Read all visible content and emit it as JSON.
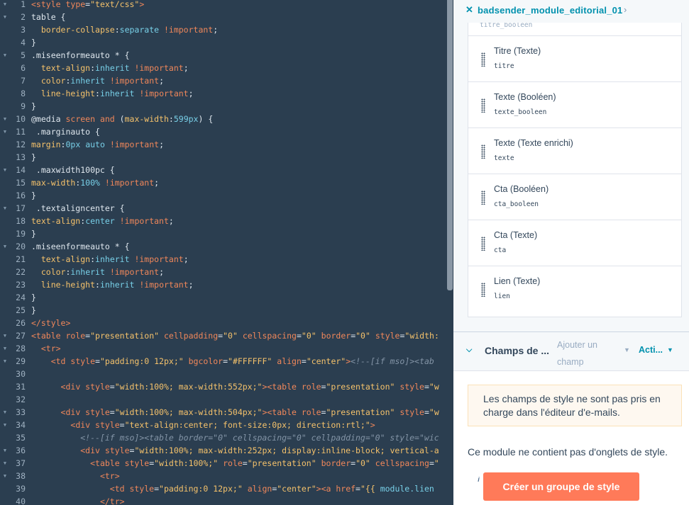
{
  "editor": {
    "lines": [
      {
        "n": "1",
        "fold": true,
        "tokens": [
          [
            "t-tag",
            "<style "
          ],
          [
            "t-attr",
            "type"
          ],
          [
            "t-plain",
            "="
          ],
          [
            "t-str",
            "\"text/css\""
          ],
          [
            "t-tag",
            ">"
          ]
        ]
      },
      {
        "n": "2",
        "fold": true,
        "tokens": [
          [
            "t-sel",
            "table "
          ],
          [
            "t-plain",
            "{"
          ]
        ]
      },
      {
        "n": "3",
        "fold": false,
        "tokens": [
          [
            "t-plain",
            "  "
          ],
          [
            "t-prop",
            "border-collapse"
          ],
          [
            "t-plain",
            ":"
          ],
          [
            "t-val",
            "separate"
          ],
          [
            "t-plain",
            " "
          ],
          [
            "t-imp",
            "!important"
          ],
          [
            "t-plain",
            ";"
          ]
        ]
      },
      {
        "n": "4",
        "fold": false,
        "tokens": [
          [
            "t-plain",
            "}"
          ]
        ]
      },
      {
        "n": "5",
        "fold": true,
        "tokens": [
          [
            "t-sel",
            ".miseenformeauto * "
          ],
          [
            "t-plain",
            "{"
          ]
        ]
      },
      {
        "n": "6",
        "fold": false,
        "tokens": [
          [
            "t-plain",
            "  "
          ],
          [
            "t-prop",
            "text-align"
          ],
          [
            "t-plain",
            ":"
          ],
          [
            "t-val",
            "inherit"
          ],
          [
            "t-plain",
            " "
          ],
          [
            "t-imp",
            "!important"
          ],
          [
            "t-plain",
            ";"
          ]
        ]
      },
      {
        "n": "7",
        "fold": false,
        "tokens": [
          [
            "t-plain",
            "  "
          ],
          [
            "t-prop",
            "color"
          ],
          [
            "t-plain",
            ":"
          ],
          [
            "t-val",
            "inherit"
          ],
          [
            "t-plain",
            " "
          ],
          [
            "t-imp",
            "!important"
          ],
          [
            "t-plain",
            ";"
          ]
        ]
      },
      {
        "n": "8",
        "fold": false,
        "tokens": [
          [
            "t-plain",
            "  "
          ],
          [
            "t-prop",
            "line-height"
          ],
          [
            "t-plain",
            ":"
          ],
          [
            "t-val",
            "inherit"
          ],
          [
            "t-plain",
            " "
          ],
          [
            "t-imp",
            "!important"
          ],
          [
            "t-plain",
            ";"
          ]
        ]
      },
      {
        "n": "9",
        "fold": false,
        "tokens": [
          [
            "t-plain",
            "}"
          ]
        ]
      },
      {
        "n": "10",
        "fold": true,
        "tokens": [
          [
            "t-plain",
            "@media "
          ],
          [
            "t-kw",
            "screen"
          ],
          [
            "t-plain",
            " "
          ],
          [
            "t-kw",
            "and"
          ],
          [
            "t-plain",
            " ("
          ],
          [
            "t-prop",
            "max-width"
          ],
          [
            "t-plain",
            ":"
          ],
          [
            "t-num",
            "599px"
          ],
          [
            "t-plain",
            ") {"
          ]
        ]
      },
      {
        "n": "11",
        "fold": true,
        "tokens": [
          [
            "t-sel",
            " .marginauto "
          ],
          [
            "t-plain",
            "{"
          ]
        ]
      },
      {
        "n": "12",
        "fold": false,
        "tokens": [
          [
            "t-prop",
            "margin"
          ],
          [
            "t-plain",
            ":"
          ],
          [
            "t-num",
            "0px"
          ],
          [
            "t-plain",
            " "
          ],
          [
            "t-val",
            "auto"
          ],
          [
            "t-plain",
            " "
          ],
          [
            "t-imp",
            "!important"
          ],
          [
            "t-plain",
            ";"
          ]
        ]
      },
      {
        "n": "13",
        "fold": false,
        "tokens": [
          [
            "t-plain",
            "}"
          ]
        ]
      },
      {
        "n": "14",
        "fold": true,
        "tokens": [
          [
            "t-sel",
            " .maxwidth100pc "
          ],
          [
            "t-plain",
            "{"
          ]
        ]
      },
      {
        "n": "15",
        "fold": false,
        "tokens": [
          [
            "t-prop",
            "max-width"
          ],
          [
            "t-plain",
            ":"
          ],
          [
            "t-num",
            "100%"
          ],
          [
            "t-plain",
            " "
          ],
          [
            "t-imp",
            "!important"
          ],
          [
            "t-plain",
            ";"
          ]
        ]
      },
      {
        "n": "16",
        "fold": false,
        "tokens": [
          [
            "t-plain",
            "}"
          ]
        ]
      },
      {
        "n": "17",
        "fold": true,
        "tokens": [
          [
            "t-sel",
            " .textaligncenter "
          ],
          [
            "t-plain",
            "{"
          ]
        ]
      },
      {
        "n": "18",
        "fold": false,
        "tokens": [
          [
            "t-prop",
            "text-align"
          ],
          [
            "t-plain",
            ":"
          ],
          [
            "t-val",
            "center"
          ],
          [
            "t-plain",
            " "
          ],
          [
            "t-imp",
            "!important"
          ],
          [
            "t-plain",
            ";"
          ]
        ]
      },
      {
        "n": "19",
        "fold": false,
        "tokens": [
          [
            "t-plain",
            "}"
          ]
        ]
      },
      {
        "n": "20",
        "fold": true,
        "tokens": [
          [
            "t-sel",
            ".miseenformeauto * "
          ],
          [
            "t-plain",
            "{"
          ]
        ]
      },
      {
        "n": "21",
        "fold": false,
        "tokens": [
          [
            "t-plain",
            "  "
          ],
          [
            "t-prop",
            "text-align"
          ],
          [
            "t-plain",
            ":"
          ],
          [
            "t-val",
            "inherit"
          ],
          [
            "t-plain",
            " "
          ],
          [
            "t-imp",
            "!important"
          ],
          [
            "t-plain",
            ";"
          ]
        ]
      },
      {
        "n": "22",
        "fold": false,
        "tokens": [
          [
            "t-plain",
            "  "
          ],
          [
            "t-prop",
            "color"
          ],
          [
            "t-plain",
            ":"
          ],
          [
            "t-val",
            "inherit"
          ],
          [
            "t-plain",
            " "
          ],
          [
            "t-imp",
            "!important"
          ],
          [
            "t-plain",
            ";"
          ]
        ]
      },
      {
        "n": "23",
        "fold": false,
        "tokens": [
          [
            "t-plain",
            "  "
          ],
          [
            "t-prop",
            "line-height"
          ],
          [
            "t-plain",
            ":"
          ],
          [
            "t-val",
            "inherit"
          ],
          [
            "t-plain",
            " "
          ],
          [
            "t-imp",
            "!important"
          ],
          [
            "t-plain",
            ";"
          ]
        ]
      },
      {
        "n": "24",
        "fold": false,
        "tokens": [
          [
            "t-plain",
            "}"
          ]
        ]
      },
      {
        "n": "25",
        "fold": false,
        "tokens": [
          [
            "t-plain",
            "}"
          ]
        ]
      },
      {
        "n": "26",
        "fold": false,
        "tokens": [
          [
            "t-tag",
            "</style>"
          ]
        ]
      },
      {
        "n": "27",
        "fold": true,
        "tokens": [
          [
            "t-tag",
            "<table "
          ],
          [
            "t-attr",
            "role"
          ],
          [
            "t-plain",
            "="
          ],
          [
            "t-str",
            "\"presentation\""
          ],
          [
            "t-plain",
            " "
          ],
          [
            "t-attr",
            "cellpadding"
          ],
          [
            "t-plain",
            "="
          ],
          [
            "t-str",
            "\"0\""
          ],
          [
            "t-plain",
            " "
          ],
          [
            "t-attr",
            "cellspacing"
          ],
          [
            "t-plain",
            "="
          ],
          [
            "t-str",
            "\"0\""
          ],
          [
            "t-plain",
            " "
          ],
          [
            "t-attr",
            "border"
          ],
          [
            "t-plain",
            "="
          ],
          [
            "t-str",
            "\"0\""
          ],
          [
            "t-plain",
            " "
          ],
          [
            "t-attr",
            "style"
          ],
          [
            "t-plain",
            "="
          ],
          [
            "t-str",
            "\"width:"
          ]
        ]
      },
      {
        "n": "28",
        "fold": true,
        "tokens": [
          [
            "t-plain",
            "  "
          ],
          [
            "t-tag",
            "<tr>"
          ]
        ]
      },
      {
        "n": "29",
        "fold": true,
        "tokens": [
          [
            "t-plain",
            "    "
          ],
          [
            "t-tag",
            "<td "
          ],
          [
            "t-attr",
            "style"
          ],
          [
            "t-plain",
            "="
          ],
          [
            "t-str",
            "\"padding:0 12px;\""
          ],
          [
            "t-plain",
            " "
          ],
          [
            "t-attr",
            "bgcolor"
          ],
          [
            "t-plain",
            "="
          ],
          [
            "t-str",
            "\"#FFFFFF\""
          ],
          [
            "t-plain",
            " "
          ],
          [
            "t-attr",
            "align"
          ],
          [
            "t-plain",
            "="
          ],
          [
            "t-str",
            "\"center\""
          ],
          [
            "t-tag",
            ">"
          ],
          [
            "t-com",
            "<!--[if mso]><tab"
          ]
        ]
      },
      {
        "n": "30",
        "fold": false,
        "tokens": []
      },
      {
        "n": "31",
        "fold": false,
        "tokens": [
          [
            "t-plain",
            "      "
          ],
          [
            "t-tag",
            "<div "
          ],
          [
            "t-attr",
            "style"
          ],
          [
            "t-plain",
            "="
          ],
          [
            "t-str",
            "\"width:100%; max-width:552px;\""
          ],
          [
            "t-tag",
            "><table "
          ],
          [
            "t-attr",
            "role"
          ],
          [
            "t-plain",
            "="
          ],
          [
            "t-str",
            "\"presentation\""
          ],
          [
            "t-plain",
            " "
          ],
          [
            "t-attr",
            "style"
          ],
          [
            "t-plain",
            "="
          ],
          [
            "t-str",
            "\"w"
          ]
        ]
      },
      {
        "n": "32",
        "fold": false,
        "tokens": []
      },
      {
        "n": "33",
        "fold": true,
        "tokens": [
          [
            "t-plain",
            "      "
          ],
          [
            "t-tag",
            "<div "
          ],
          [
            "t-attr",
            "style"
          ],
          [
            "t-plain",
            "="
          ],
          [
            "t-str",
            "\"width:100%; max-width:504px;\""
          ],
          [
            "t-tag",
            "><table "
          ],
          [
            "t-attr",
            "role"
          ],
          [
            "t-plain",
            "="
          ],
          [
            "t-str",
            "\"presentation\""
          ],
          [
            "t-plain",
            " "
          ],
          [
            "t-attr",
            "style"
          ],
          [
            "t-plain",
            "="
          ],
          [
            "t-str",
            "\"w"
          ]
        ]
      },
      {
        "n": "34",
        "fold": true,
        "tokens": [
          [
            "t-plain",
            "        "
          ],
          [
            "t-tag",
            "<div "
          ],
          [
            "t-attr",
            "style"
          ],
          [
            "t-plain",
            "="
          ],
          [
            "t-str",
            "\"text-align:center; font-size:0px; direction:rtl;\""
          ],
          [
            "t-tag",
            ">"
          ]
        ]
      },
      {
        "n": "35",
        "fold": false,
        "tokens": [
          [
            "t-plain",
            "          "
          ],
          [
            "t-com",
            "<!--[if mso]><table border=\"0\" cellspacing=\"0\" cellpadding=\"0\" style=\"wic"
          ]
        ]
      },
      {
        "n": "36",
        "fold": true,
        "tokens": [
          [
            "t-plain",
            "          "
          ],
          [
            "t-tag",
            "<div "
          ],
          [
            "t-attr",
            "style"
          ],
          [
            "t-plain",
            "="
          ],
          [
            "t-str",
            "\"width:100%; max-width:252px; display:inline-block; vertical-a"
          ]
        ]
      },
      {
        "n": "37",
        "fold": true,
        "tokens": [
          [
            "t-plain",
            "            "
          ],
          [
            "t-tag",
            "<table "
          ],
          [
            "t-attr",
            "style"
          ],
          [
            "t-plain",
            "="
          ],
          [
            "t-str",
            "\"width:100%;\""
          ],
          [
            "t-plain",
            " "
          ],
          [
            "t-attr",
            "role"
          ],
          [
            "t-plain",
            "="
          ],
          [
            "t-str",
            "\"presentation\""
          ],
          [
            "t-plain",
            " "
          ],
          [
            "t-attr",
            "border"
          ],
          [
            "t-plain",
            "="
          ],
          [
            "t-str",
            "\"0\""
          ],
          [
            "t-plain",
            " "
          ],
          [
            "t-attr",
            "cellspacing"
          ],
          [
            "t-plain",
            "="
          ],
          [
            "t-str",
            "\""
          ]
        ]
      },
      {
        "n": "38",
        "fold": true,
        "tokens": [
          [
            "t-plain",
            "              "
          ],
          [
            "t-tag",
            "<tr>"
          ]
        ]
      },
      {
        "n": "39",
        "fold": false,
        "tokens": [
          [
            "t-plain",
            "                "
          ],
          [
            "t-tag",
            "<td "
          ],
          [
            "t-attr",
            "style"
          ],
          [
            "t-plain",
            "="
          ],
          [
            "t-str",
            "\"padding:0 12px;\""
          ],
          [
            "t-plain",
            " "
          ],
          [
            "t-attr",
            "align"
          ],
          [
            "t-plain",
            "="
          ],
          [
            "t-str",
            "\"center\""
          ],
          [
            "t-tag",
            "><a "
          ],
          [
            "t-attr",
            "href"
          ],
          [
            "t-plain",
            "="
          ],
          [
            "t-str",
            "\"{{ "
          ],
          [
            "t-val",
            "module.lien"
          ]
        ]
      },
      {
        "n": "40",
        "fold": false,
        "tokens": [
          [
            "t-plain",
            "              "
          ],
          [
            "t-tag",
            "</tr>"
          ]
        ]
      }
    ]
  },
  "panel": {
    "module_icon": "✕",
    "module_name": "badsender_module_editorial_01",
    "cut_off_key": "titre_booleen",
    "fields": [
      {
        "label": "Titre (Texte)",
        "key": "titre"
      },
      {
        "label": "Texte (Booléen)",
        "key": "texte_booleen"
      },
      {
        "label": "Texte (Texte enrichi)",
        "key": "texte"
      },
      {
        "label": "Cta (Booléen)",
        "key": "cta_booleen"
      },
      {
        "label": "Cta (Texte)",
        "key": "cta"
      },
      {
        "label": "Lien (Texte)",
        "key": "lien"
      }
    ],
    "style_section": {
      "title": "Champs de ...",
      "add_field": "Ajouter un champ",
      "actions": "Acti...",
      "alert": "Les champs de style ne sont pas pris en charge dans l'éditeur d'e-mails.",
      "no_tabs": "Ce module ne contient pas d'onglets de style.",
      "info_icon": "i",
      "create_button": "Créer un groupe de style"
    }
  }
}
